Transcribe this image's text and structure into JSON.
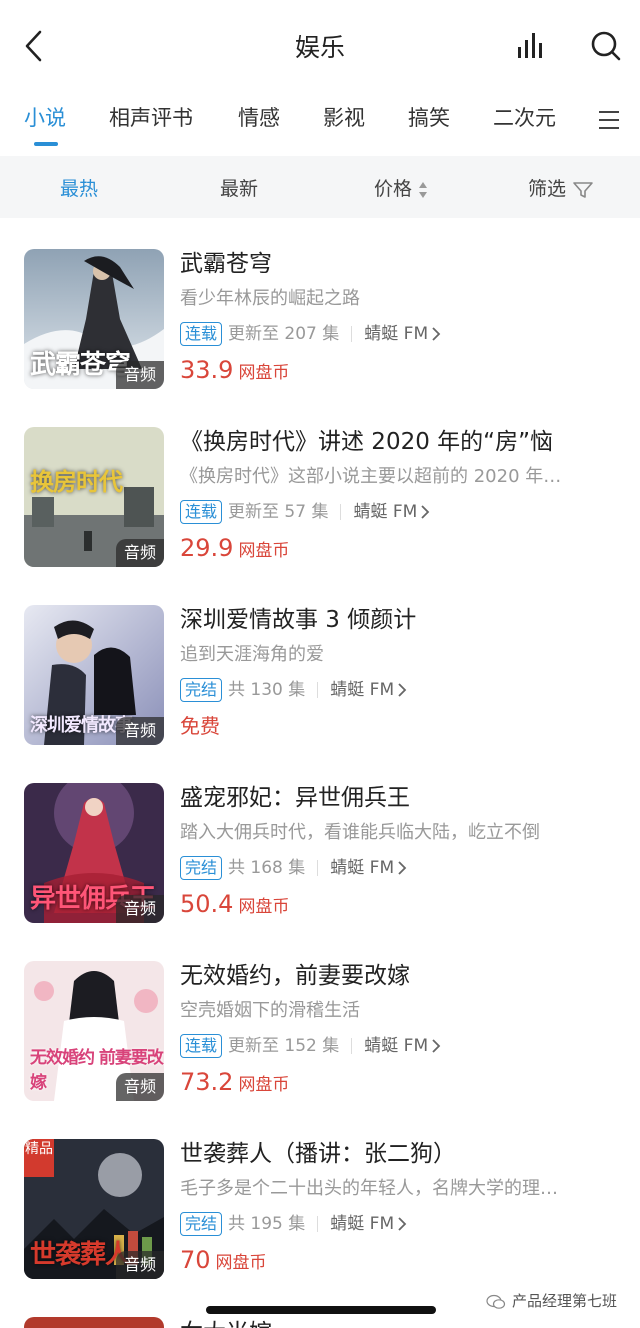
{
  "header": {
    "title": "娱乐",
    "back_icon": "back-arrow-icon",
    "chart_icon": "bar-chart-icon",
    "search_icon": "search-icon"
  },
  "tabs": [
    {
      "label": "小说",
      "active": true
    },
    {
      "label": "相声评书",
      "active": false
    },
    {
      "label": "情感",
      "active": false
    },
    {
      "label": "影视",
      "active": false
    },
    {
      "label": "搞笑",
      "active": false
    },
    {
      "label": "二次元",
      "active": false
    }
  ],
  "tabs_menu_icon": "hamburger-menu-icon",
  "filters": {
    "hot": "最热",
    "new": "最新",
    "price": "价格",
    "filter": "筛选"
  },
  "colors": {
    "accent": "#2a8fd6",
    "price": "#d9463a",
    "muted": "#999999"
  },
  "items": [
    {
      "title": "武霸苍穹",
      "desc": "看少年林辰的崛起之路",
      "status": "连载",
      "episodes": "更新至 207 集",
      "source": "蜻蜓 FM",
      "price": "33.9",
      "unit": "网盘币",
      "badge": "音频",
      "cover_text": "武霸苍穹"
    },
    {
      "title": "《换房时代》讲述 2020 年的“房”恼",
      "desc": "《换房时代》这部小说主要以超前的 2020 年…",
      "status": "连载",
      "episodes": "更新至 57 集",
      "source": "蜻蜓 FM",
      "price": "29.9",
      "unit": "网盘币",
      "badge": "音频",
      "cover_text": "换房时代"
    },
    {
      "title": "深圳爱情故事 3 倾颜计",
      "desc": "追到天涯海角的爱",
      "status": "完结",
      "episodes": "共 130 集",
      "source": "蜻蜓 FM",
      "free": "免费",
      "badge": "音频",
      "cover_text": "深圳爱情故事"
    },
    {
      "title": "盛宠邪妃：异世佣兵王",
      "desc": "踏入大佣兵时代，看谁能兵临大陆，屹立不倒",
      "status": "完结",
      "episodes": "共 168 集",
      "source": "蜻蜓 FM",
      "price": "50.4",
      "unit": "网盘币",
      "badge": "音频",
      "cover_text": "异世佣兵王"
    },
    {
      "title": "无效婚约，前妻要改嫁",
      "desc": "空壳婚姻下的滑稽生活",
      "status": "连载",
      "episodes": "更新至 152 集",
      "source": "蜻蜓 FM",
      "price": "73.2",
      "unit": "网盘币",
      "badge": "音频",
      "cover_text": "无效婚约 前妻要改嫁"
    },
    {
      "title": "世袭葬人（播讲：张二狗）",
      "desc": "毛子多是个二十出头的年轻人，名牌大学的理…",
      "status": "完结",
      "episodes": "共 195 集",
      "source": "蜻蜓 FM",
      "price": "70",
      "unit": "网盘币",
      "badge": "音频",
      "premium": "精品",
      "cover_text": "世袭葬人"
    }
  ],
  "partial_item_title": "女大当嫁",
  "watermark": "产品经理第七班"
}
